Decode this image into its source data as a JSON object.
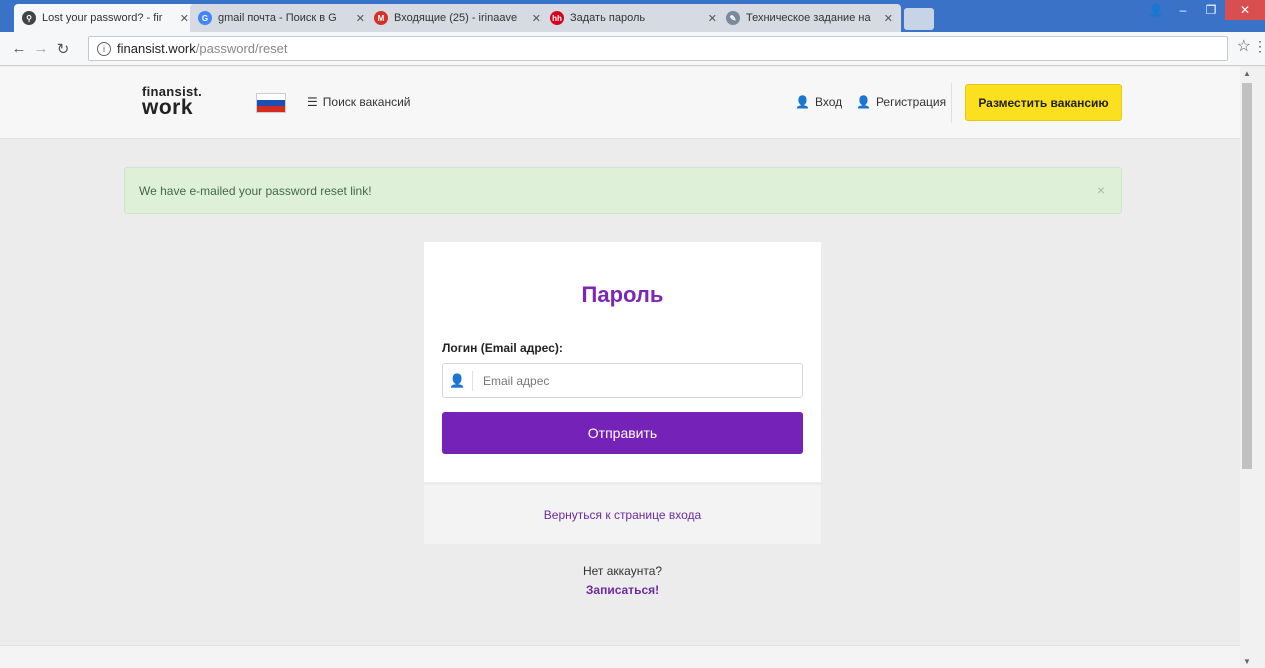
{
  "browser": {
    "tabs": [
      {
        "title": "Lost your password? - fir",
        "favicon": "search-favicon"
      },
      {
        "title": "gmail почта - Поиск в G",
        "favicon": "google-favicon"
      },
      {
        "title": "Входящие (25) - irinaave",
        "favicon": "gmail-favicon"
      },
      {
        "title": "Задать пароль",
        "favicon": "hh-favicon"
      },
      {
        "title": "Техническое задание на",
        "favicon": "doc-favicon"
      }
    ],
    "url_host": "finansist.work",
    "url_path": "/password/reset"
  },
  "header": {
    "logo_line1": "finansist.",
    "logo_line2": "work",
    "flag_colors": [
      "#ffffff",
      "#1c4fb4",
      "#d52b1e"
    ],
    "search_jobs": "Поиск вакансий",
    "login": "Вход",
    "register": "Регистрация",
    "post_vacancy": "Разместить вакансию"
  },
  "alert": {
    "message": "We have e-mailed your password reset link!",
    "close": "×"
  },
  "form": {
    "title": "Пароль",
    "email_label": "Логин (Email адрес):",
    "email_placeholder": "Email адрес",
    "email_value": "",
    "submit": "Отправить"
  },
  "links": {
    "back_to_login": "Вернуться к странице входа",
    "no_account": "Нет аккаунта?",
    "signup": "Записаться!"
  },
  "colors": {
    "accent_purple": "#7422b8",
    "button_yellow": "#fae01e",
    "alert_green": "#dff0d8",
    "chrome_blue": "#3a72c8"
  }
}
